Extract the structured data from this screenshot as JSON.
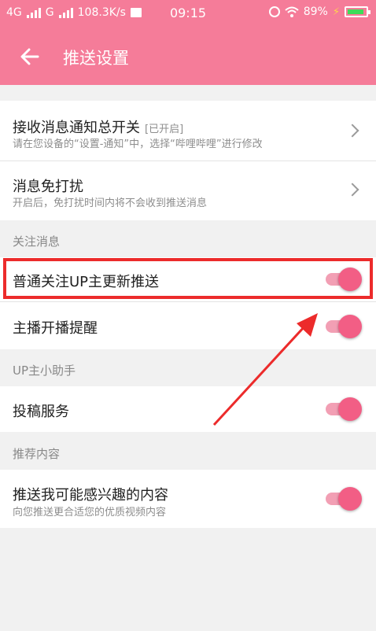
{
  "status": {
    "net1": "4G",
    "net2": "G",
    "speed": "108.3K/s",
    "time": "09:15",
    "battery": "89%"
  },
  "appbar": {
    "title": "推送设置"
  },
  "settings": {
    "master": {
      "title": "接收消息通知总开关",
      "tag": "[已开启]",
      "desc": "请在您设备的“设置-通知”中，选择“哔哩哔哩”进行修改"
    },
    "dnd": {
      "title": "消息免打扰",
      "desc": "开启后，免打扰时间内将不会收到推送消息"
    }
  },
  "sections": {
    "follow": "关注消息",
    "up_helper": "UP主小助手",
    "recommend": "推荐内容"
  },
  "toggles": {
    "follow_up": {
      "label": "普通关注UP主更新推送",
      "on": true
    },
    "live": {
      "label": "主播开播提醒",
      "on": true
    },
    "submit": {
      "label": "投稿服务",
      "on": true
    },
    "interest": {
      "label": "推送我可能感兴趣的内容",
      "desc": "向您推送更合适您的优质视频内容",
      "on": true
    }
  },
  "colors": {
    "accent": "#f57c99",
    "toggle_on": "#f25e85",
    "highlight": "#ec2b2b"
  }
}
